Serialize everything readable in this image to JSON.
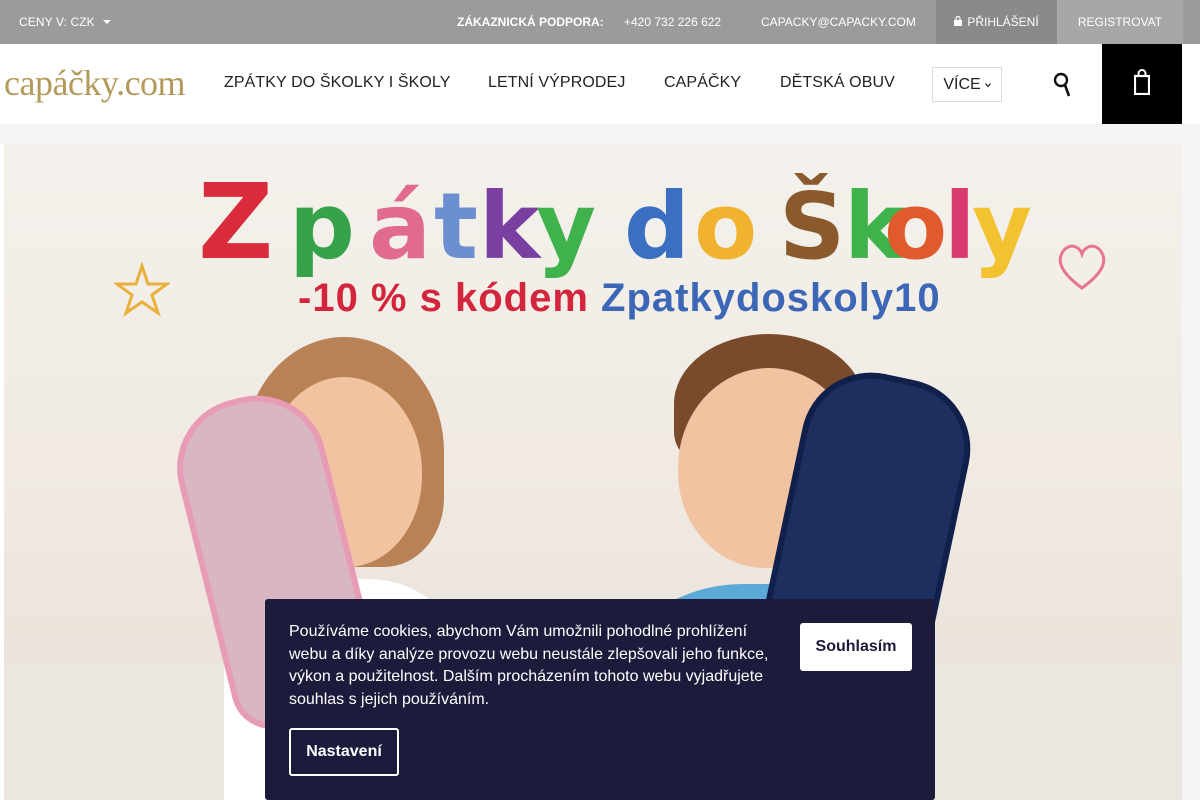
{
  "topbar": {
    "currency_label": "CENY V: CZK",
    "support_label": "ZÁKAZNICKÁ PODPORA:",
    "phone": "+420 732 226 622",
    "email": "CAPACKY@CAPACKY.COM",
    "login_label": "PŘIHLÁŠENÍ",
    "register_label": "REGISTROVAT"
  },
  "header": {
    "logo": "capáčky.com",
    "nav": [
      {
        "label": "ZPÁTKY DO ŠKOLKY I ŠKOLY"
      },
      {
        "label": "LETNÍ VÝPRODEJ"
      },
      {
        "label": "CAPÁČKY"
      },
      {
        "label": "DĚTSKÁ OBUV"
      }
    ],
    "more_label": "VÍCE",
    "icons": {
      "search": "search-icon",
      "cart": "cart-icon",
      "login": "lock-icon",
      "more": "chevron-down-icon"
    }
  },
  "banner": {
    "title_letters": [
      "Z",
      "p",
      "á",
      "t",
      "k",
      "y",
      "d",
      "o",
      "Š",
      "k",
      "o",
      "l",
      "y"
    ],
    "title_colors": [
      "#d92b3a",
      "#36a34a",
      "#e06b8f",
      "#6c8fd1",
      "#7a3fa0",
      "#3fb24c",
      "#3a6fc2",
      "#f0b22f",
      "#8a5a2c",
      "#3fb24c",
      "#e05a2b",
      "#d83b6e",
      "#f2c230"
    ],
    "discount_text": "-10 % s kódem",
    "code_text": "Zpatkydoskoly10"
  },
  "cookie": {
    "text": "Používáme cookies, abychom Vám umožnili pohodlné prohlížení webu a díky analýze provozu webu neustále zlepšovali jeho funkce, výkon a použitelnost. Dalším procházením tohoto webu vyjadřujete souhlas s jejich používáním.",
    "agree_label": "Souhlasím",
    "settings_label": "Nastavení"
  },
  "colors": {
    "topbar_bg": "#9b9b9b",
    "logo_gold": "#b39a5b",
    "cookie_bg": "#1c1b3c",
    "cart_bg": "#000000"
  }
}
